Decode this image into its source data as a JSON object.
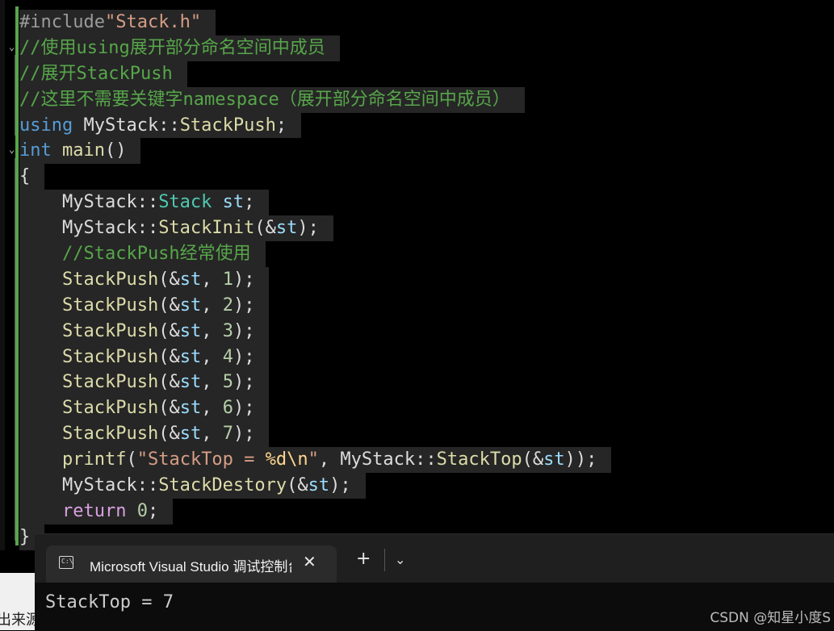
{
  "editor": {
    "lines": [
      [
        {
          "t": "#include",
          "c": "pp"
        },
        {
          "t": "\"Stack.h\"",
          "c": "str"
        }
      ],
      [
        {
          "t": "//使用using展开部分命名空间中成员",
          "c": "cm"
        }
      ],
      [
        {
          "t": "//展开StackPush",
          "c": "cm"
        }
      ],
      [
        {
          "t": "//这里不需要关键字namespace（展开部分命名空间中成员）",
          "c": "cm"
        }
      ],
      [
        {
          "t": "using",
          "c": "kw"
        },
        {
          "t": " MyStack::",
          "c": ""
        },
        {
          "t": "StackPush",
          "c": "fn"
        },
        {
          "t": ";",
          "c": ""
        }
      ],
      [
        {
          "t": "int",
          "c": "kw"
        },
        {
          "t": " ",
          "c": ""
        },
        {
          "t": "main",
          "c": "fn"
        },
        {
          "t": "()",
          "c": ""
        }
      ],
      [
        {
          "t": "{",
          "c": ""
        }
      ],
      [
        {
          "t": "    MyStack::",
          "c": ""
        },
        {
          "t": "Stack",
          "c": "ty"
        },
        {
          "t": " ",
          "c": ""
        },
        {
          "t": "st",
          "c": "var"
        },
        {
          "t": ";",
          "c": ""
        }
      ],
      [
        {
          "t": "    MyStack::",
          "c": ""
        },
        {
          "t": "StackInit",
          "c": "fn"
        },
        {
          "t": "(&",
          "c": ""
        },
        {
          "t": "st",
          "c": "var"
        },
        {
          "t": ");",
          "c": ""
        }
      ],
      [
        {
          "t": "    //StackPush经常使用",
          "c": "cm"
        }
      ],
      [
        {
          "t": "    ",
          "c": ""
        },
        {
          "t": "StackPush",
          "c": "fn"
        },
        {
          "t": "(&",
          "c": ""
        },
        {
          "t": "st",
          "c": "var"
        },
        {
          "t": ", ",
          "c": ""
        },
        {
          "t": "1",
          "c": "num"
        },
        {
          "t": ");",
          "c": ""
        }
      ],
      [
        {
          "t": "    ",
          "c": ""
        },
        {
          "t": "StackPush",
          "c": "fn"
        },
        {
          "t": "(&",
          "c": ""
        },
        {
          "t": "st",
          "c": "var"
        },
        {
          "t": ", ",
          "c": ""
        },
        {
          "t": "2",
          "c": "num"
        },
        {
          "t": ");",
          "c": ""
        }
      ],
      [
        {
          "t": "    ",
          "c": ""
        },
        {
          "t": "StackPush",
          "c": "fn"
        },
        {
          "t": "(&",
          "c": ""
        },
        {
          "t": "st",
          "c": "var"
        },
        {
          "t": ", ",
          "c": ""
        },
        {
          "t": "3",
          "c": "num"
        },
        {
          "t": ");",
          "c": ""
        }
      ],
      [
        {
          "t": "    ",
          "c": ""
        },
        {
          "t": "StackPush",
          "c": "fn"
        },
        {
          "t": "(&",
          "c": ""
        },
        {
          "t": "st",
          "c": "var"
        },
        {
          "t": ", ",
          "c": ""
        },
        {
          "t": "4",
          "c": "num"
        },
        {
          "t": ");",
          "c": ""
        }
      ],
      [
        {
          "t": "    ",
          "c": ""
        },
        {
          "t": "StackPush",
          "c": "fn"
        },
        {
          "t": "(&",
          "c": ""
        },
        {
          "t": "st",
          "c": "var"
        },
        {
          "t": ", ",
          "c": ""
        },
        {
          "t": "5",
          "c": "num"
        },
        {
          "t": ");",
          "c": ""
        }
      ],
      [
        {
          "t": "    ",
          "c": ""
        },
        {
          "t": "StackPush",
          "c": "fn"
        },
        {
          "t": "(&",
          "c": ""
        },
        {
          "t": "st",
          "c": "var"
        },
        {
          "t": ", ",
          "c": ""
        },
        {
          "t": "6",
          "c": "num"
        },
        {
          "t": ");",
          "c": ""
        }
      ],
      [
        {
          "t": "    ",
          "c": ""
        },
        {
          "t": "StackPush",
          "c": "fn"
        },
        {
          "t": "(&",
          "c": ""
        },
        {
          "t": "st",
          "c": "var"
        },
        {
          "t": ", ",
          "c": ""
        },
        {
          "t": "7",
          "c": "num"
        },
        {
          "t": ");",
          "c": ""
        }
      ],
      [
        {
          "t": "    ",
          "c": ""
        },
        {
          "t": "printf",
          "c": "fn"
        },
        {
          "t": "(",
          "c": ""
        },
        {
          "t": "\"StackTop = ",
          "c": "str"
        },
        {
          "t": "%d\\n",
          "c": "esc"
        },
        {
          "t": "\"",
          "c": "str"
        },
        {
          "t": ", MyStack::",
          "c": ""
        },
        {
          "t": "StackTop",
          "c": "fn"
        },
        {
          "t": "(&",
          "c": ""
        },
        {
          "t": "st",
          "c": "var"
        },
        {
          "t": "));",
          "c": ""
        }
      ],
      [
        {
          "t": "    MyStack::",
          "c": ""
        },
        {
          "t": "StackDestory",
          "c": "fn"
        },
        {
          "t": "(&",
          "c": ""
        },
        {
          "t": "st",
          "c": "var"
        },
        {
          "t": ");",
          "c": ""
        }
      ],
      [
        {
          "t": "    ",
          "c": ""
        },
        {
          "t": "return",
          "c": "ctl"
        },
        {
          "t": " ",
          "c": ""
        },
        {
          "t": "0",
          "c": "num"
        },
        {
          "t": ";",
          "c": ""
        }
      ],
      [
        {
          "t": "}",
          "c": ""
        }
      ]
    ]
  },
  "console": {
    "tab_title": "Microsoft Visual Studio 调试控制台",
    "tab_icon": "terminal-icon",
    "close_icon": "close-icon",
    "new_tab_label": "+",
    "dropdown_icon": "chevron-down-icon",
    "output": "StackTop = 7"
  },
  "background_strip_text": "出来源",
  "watermark": "CSDN @知星小度S",
  "colors": {
    "background": "#000000",
    "comment": "#57a64a",
    "keyword": "#569cd6",
    "function": "#dcdcaa",
    "string": "#d69d85"
  }
}
